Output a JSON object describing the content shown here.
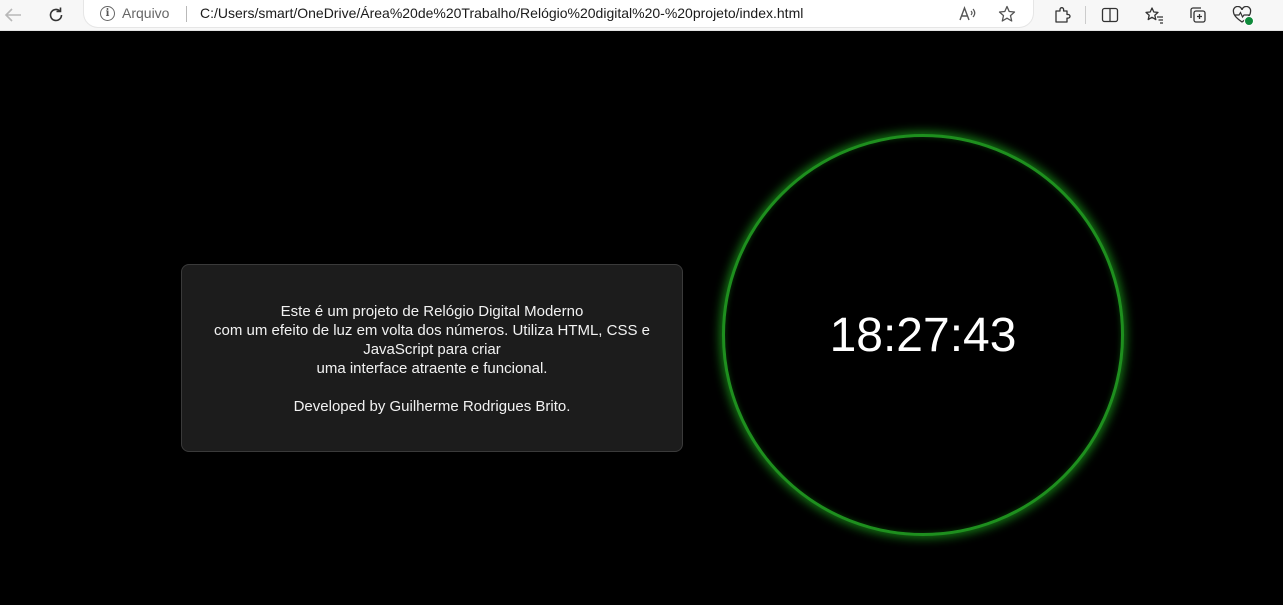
{
  "browser": {
    "site_label": "Arquivo",
    "url": "C:/Users/smart/OneDrive/Área%20de%20Trabalho/Relógio%20digital%20-%20projeto/index.html",
    "icons": [
      "back-arrow-icon",
      "refresh-icon",
      "info-icon",
      "read-aloud-icon",
      "favorite-star-icon",
      "extensions-icon",
      "split-screen-icon",
      "favorites-icon",
      "collections-icon",
      "browser-essentials-icon"
    ],
    "accent_color": "#0f8a3b"
  },
  "card": {
    "lines": [
      "Este é um projeto de Relógio Digital Moderno",
      "com um efeito de luz em volta dos números. Utiliza HTML, CSS e",
      "JavaScript para criar",
      "uma interface atraente e funcional."
    ],
    "credit": "Developed by Guilherme Rodrigues Brito."
  },
  "clock": {
    "time": "18:27:43",
    "glow_color": "#1e8f1e"
  }
}
